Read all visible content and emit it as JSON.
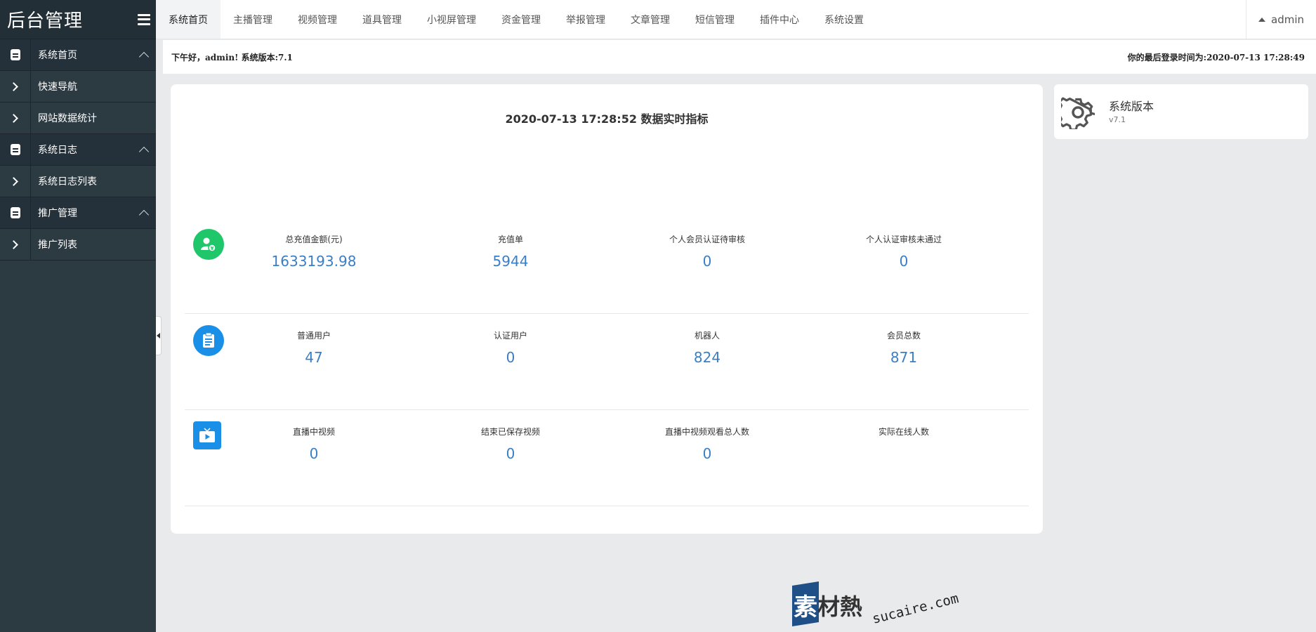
{
  "sidebar": {
    "brand": "后台管理",
    "items": [
      {
        "label": "系统首页",
        "type": "group"
      },
      {
        "label": "快速导航",
        "type": "sub"
      },
      {
        "label": "网站数据统计",
        "type": "sub"
      },
      {
        "label": "系统日志",
        "type": "group"
      },
      {
        "label": "系统日志列表",
        "type": "sub"
      },
      {
        "label": "推广管理",
        "type": "group"
      },
      {
        "label": "推广列表",
        "type": "sub"
      }
    ]
  },
  "topnav": {
    "tabs": [
      "系统首页",
      "主播管理",
      "视频管理",
      "道具管理",
      "小视屏管理",
      "资金管理",
      "举报管理",
      "文章管理",
      "短信管理",
      "插件中心",
      "系统设置"
    ],
    "active_index": 0,
    "user": "admin"
  },
  "greeting": {
    "left": "下午好，admin! 系统版本:7.1",
    "right": "你的最后登录时间为:2020-07-13 17:28:49"
  },
  "dashboard": {
    "title": "2020-07-13 17:28:52 数据实时指标",
    "rows": [
      {
        "icon": "user-money-icon",
        "stats": [
          {
            "label": "总充值金额(元)",
            "value": "1633193.98"
          },
          {
            "label": "充值单",
            "value": "5944"
          },
          {
            "label": "个人会员认证待审核",
            "value": "0"
          },
          {
            "label": "个人认证审核未通过",
            "value": "0"
          }
        ]
      },
      {
        "icon": "clipboard-icon",
        "stats": [
          {
            "label": "普通用户",
            "value": "47"
          },
          {
            "label": "认证用户",
            "value": "0"
          },
          {
            "label": "机器人",
            "value": "824"
          },
          {
            "label": "会员总数",
            "value": "871"
          }
        ]
      },
      {
        "icon": "tv-play-icon",
        "stats": [
          {
            "label": "直播中视频",
            "value": "0"
          },
          {
            "label": "结束已保存视频",
            "value": "0"
          },
          {
            "label": "直播中视频观看总人数",
            "value": "0"
          },
          {
            "label": "实际在线人数",
            "value": ""
          }
        ]
      }
    ]
  },
  "version_card": {
    "title": "系统版本",
    "value": "v7.1"
  },
  "watermark": {
    "main": "素材熱",
    "domain": "sucaire.com"
  },
  "colors": {
    "sidebar_bg": "#2c3a42",
    "accent_blue": "#3a7ec6",
    "icon_green": "#1fc66a",
    "icon_blue": "#1a8fe8"
  }
}
